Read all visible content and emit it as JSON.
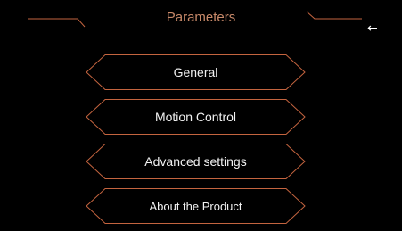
{
  "header": {
    "title": "Parameters",
    "back_glyph": "←"
  },
  "menu": {
    "items": [
      {
        "label": "General"
      },
      {
        "label": "Motion Control"
      },
      {
        "label": "Advanced settings"
      },
      {
        "label": "About the Product"
      }
    ]
  },
  "colors": {
    "background": "#000000",
    "accent": "#c4643f",
    "title": "#c98a6a",
    "text": "#f2f2f2"
  }
}
